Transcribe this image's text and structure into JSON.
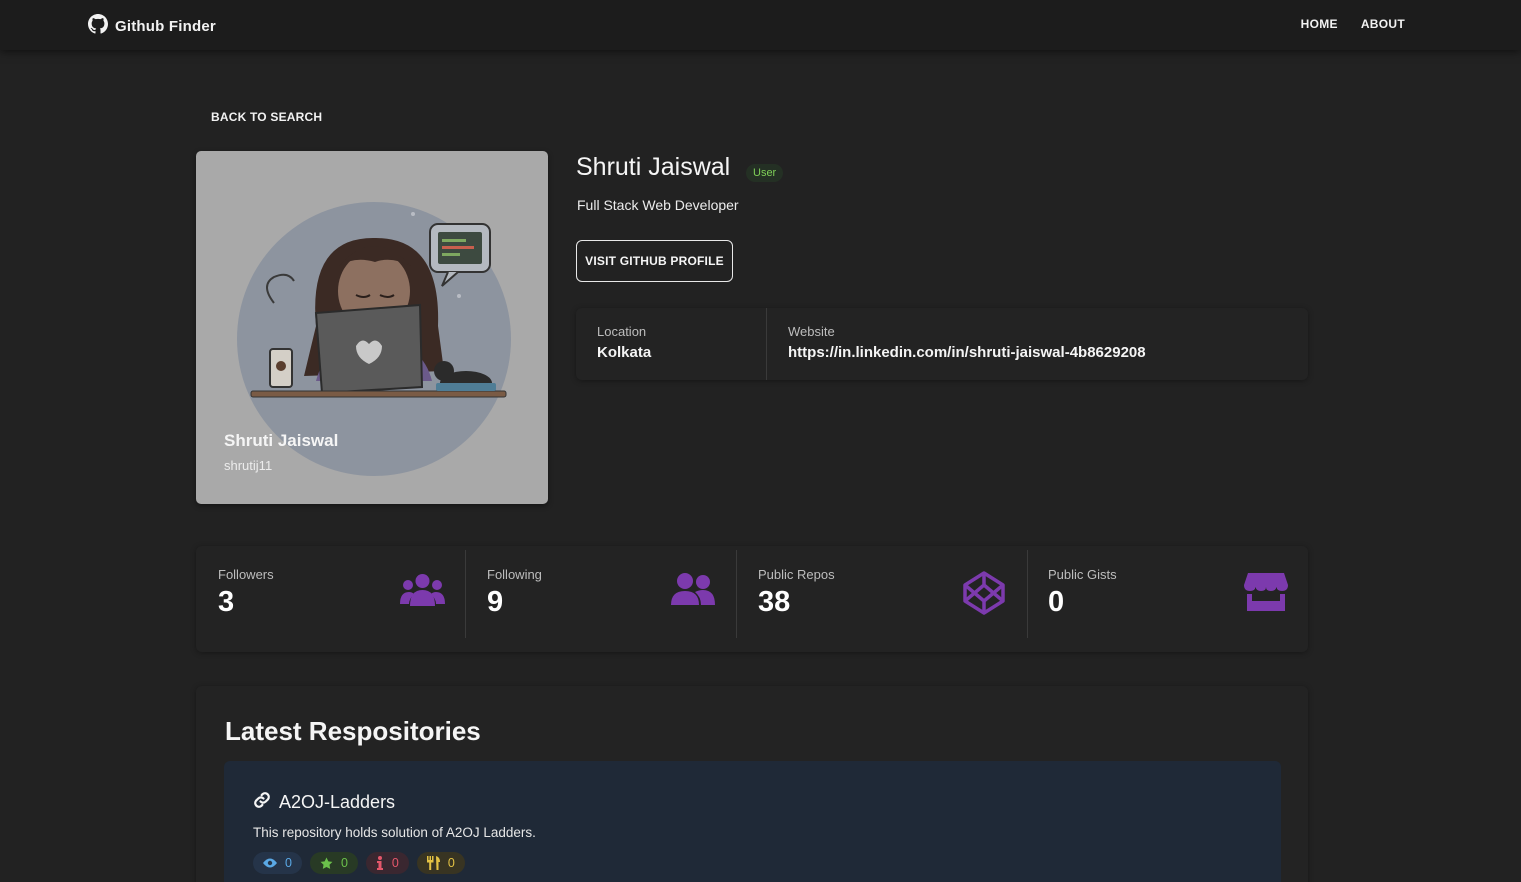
{
  "navbar": {
    "brand": "Github Finder",
    "links": [
      "HOME",
      "ABOUT"
    ]
  },
  "back_label": "BACK TO SEARCH",
  "avatar": {
    "name": "Shruti Jaiswal",
    "login": "shrutij11"
  },
  "profile": {
    "name": "Shruti Jaiswal",
    "type_badge": "User",
    "bio": "Full Stack Web Developer",
    "visit_label": "VISIT GITHUB PROFILE"
  },
  "info": {
    "location_label": "Location",
    "location": "Kolkata",
    "website_label": "Website",
    "website": "https://in.linkedin.com/in/shruti-jaiswal-4b8629208"
  },
  "stats": [
    {
      "label": "Followers",
      "value": "3",
      "icon": "users-icon"
    },
    {
      "label": "Following",
      "value": "9",
      "icon": "user-friends-icon"
    },
    {
      "label": "Public Repos",
      "value": "38",
      "icon": "codepen-icon"
    },
    {
      "label": "Public Gists",
      "value": "0",
      "icon": "store-icon"
    }
  ],
  "accent_color": "#7c3aad",
  "repos": {
    "title": "Latest Respositories",
    "items": [
      {
        "name": "A2OJ-Ladders",
        "description": "This repository holds solution of A2OJ Ladders.",
        "watchers": "0",
        "stars": "0",
        "issues": "0",
        "forks": "0"
      }
    ]
  }
}
